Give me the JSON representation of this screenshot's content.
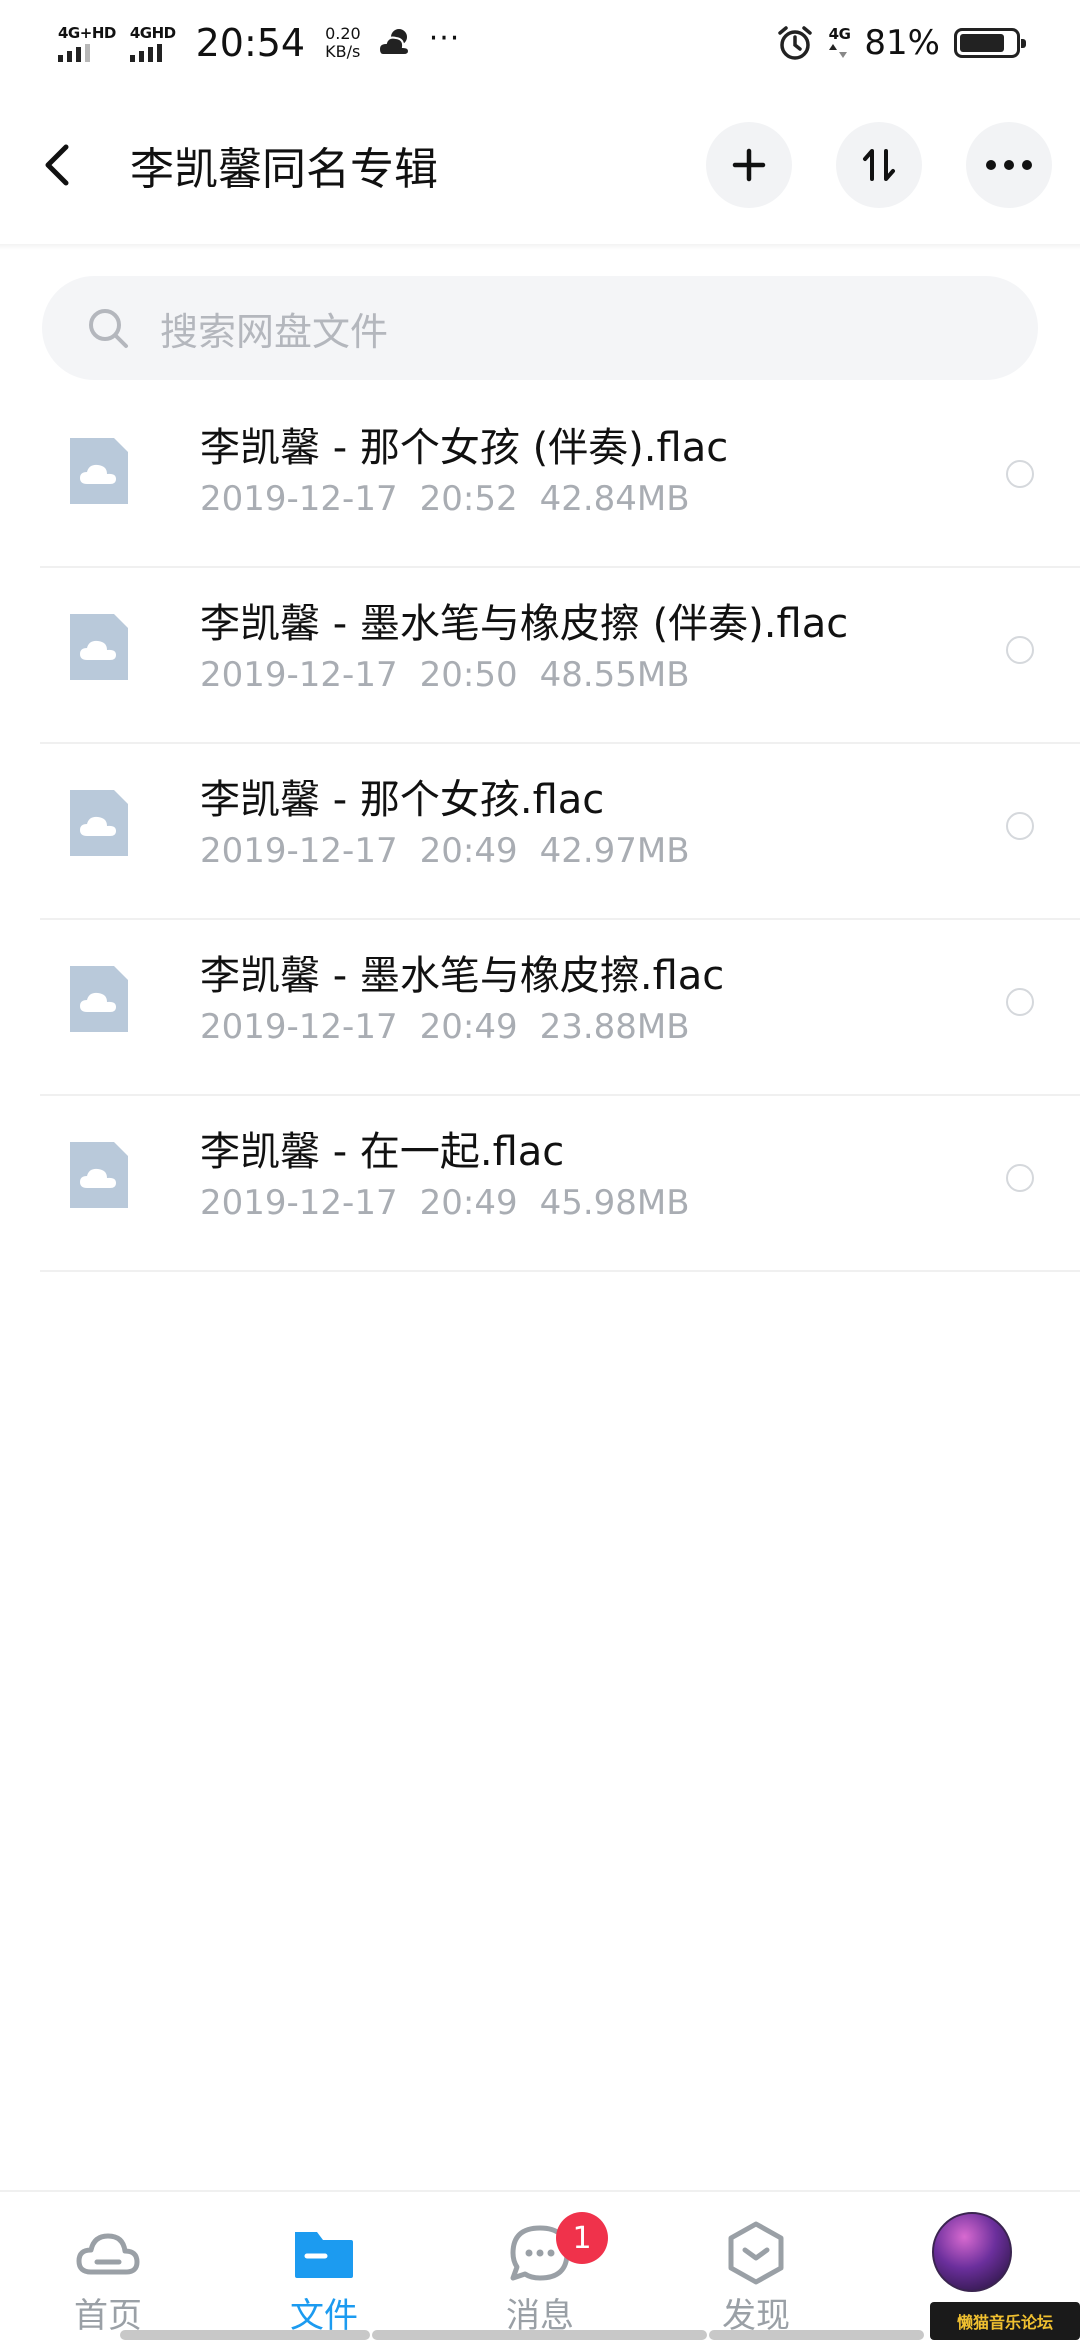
{
  "status_bar": {
    "network1": "4G+HD",
    "network2": "4GHD",
    "time": "20:54",
    "speed_value": "0.20",
    "speed_unit": "KB/s",
    "more": "···",
    "network3": "4G",
    "battery_percent": "81%",
    "battery_level": 0.81
  },
  "header": {
    "title": "李凯馨同名专辑",
    "back_icon": "chevron-left-icon",
    "add_icon": "plus-icon",
    "sort_icon": "sort-icon",
    "more_icon": "more-icon"
  },
  "search": {
    "placeholder": "搜索网盘文件"
  },
  "files": [
    {
      "name": "李凯馨 - 那个女孩 (伴奏).flac",
      "date": "2019-12-17",
      "time": "20:52",
      "size": "42.84MB"
    },
    {
      "name": "李凯馨 - 墨水笔与橡皮擦 (伴奏).flac",
      "date": "2019-12-17",
      "time": "20:50",
      "size": "48.55MB"
    },
    {
      "name": "李凯馨 - 那个女孩.flac",
      "date": "2019-12-17",
      "time": "20:49",
      "size": "42.97MB"
    },
    {
      "name": "李凯馨 - 墨水笔与橡皮擦.flac",
      "date": "2019-12-17",
      "time": "20:49",
      "size": "23.88MB"
    },
    {
      "name": "李凯馨 - 在一起.flac",
      "date": "2019-12-17",
      "time": "20:49",
      "size": "45.98MB"
    }
  ],
  "nav": {
    "home": "首页",
    "files": "文件",
    "messages": "消息",
    "messages_badge": "1",
    "discover": "发现"
  },
  "watermark": "懒猫音乐论坛",
  "colors": {
    "accent": "#1c9bf0",
    "badge": "#f0324b",
    "file_icon": "#b9c9da"
  }
}
